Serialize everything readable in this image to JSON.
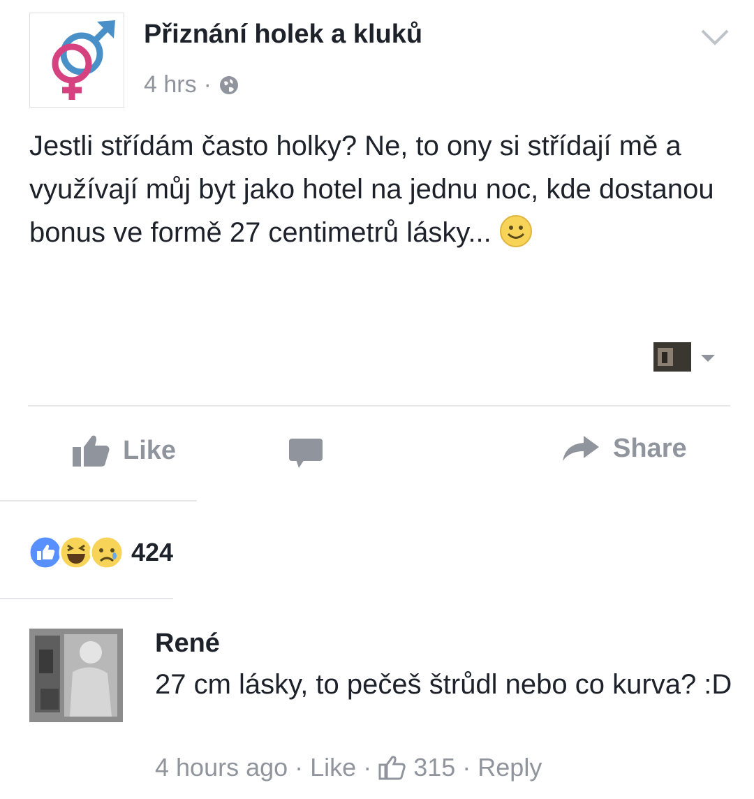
{
  "post": {
    "page_name": "Přiznání holek a kluků",
    "time": "4 hrs",
    "separator": "·",
    "text": "Jestli střídám často holky? Ne, to ony si střídají mě a využívají můj byt jako hotel na jednu noc, kde dostanou bonus ve formě 27 centimetrů lásky...",
    "icons": {
      "avatar": "gender-symbol-icon",
      "audience": "globe-icon",
      "menu": "chevron-down-icon",
      "emoji": "smiley-icon"
    }
  },
  "actions": {
    "like_label": "Like",
    "share_label": "Share",
    "icons": [
      "thumbs-up-icon",
      "comment-icon",
      "share-arrow-icon"
    ]
  },
  "reactions": {
    "icons": [
      "like-reaction-icon",
      "haha-reaction-icon",
      "sad-reaction-icon"
    ],
    "count": "424"
  },
  "comment": {
    "author": "René",
    "text": "27 cm lásky,  to pečeš štrůdl nebo co kurva? :D",
    "time": "4 hours ago",
    "like_label": "Like",
    "like_count": "315",
    "reply_label": "Reply",
    "separator": "·"
  },
  "colors": {
    "text": "#1d2129",
    "muted": "#90949c",
    "divider": "#e5e6e9",
    "like_blue": "#5890ff",
    "male_blue": "#4a90c8",
    "female_pink": "#d6417f",
    "emoji_yellow": "#f7d358"
  }
}
